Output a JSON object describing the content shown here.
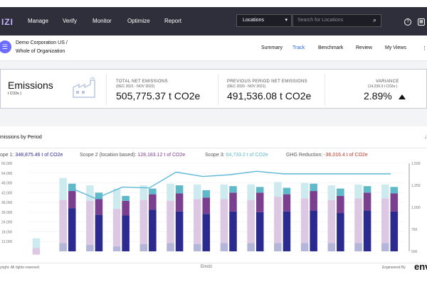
{
  "app": {
    "logo": "IZI"
  },
  "nav": {
    "items": [
      "Manage",
      "Verify",
      "Monitor",
      "Optimize",
      "Report"
    ]
  },
  "location_select": {
    "value": "Locations",
    "chevron": "▾"
  },
  "search": {
    "placeholder": "Search for Locations",
    "icon": "search-icon"
  },
  "top_icons": [
    "help-icon",
    "apps-icon"
  ],
  "breadcrumb": {
    "org": "Demo Corporation US",
    "separator": "/",
    "scope": "Whole of Organization"
  },
  "tabs": {
    "items": [
      "Summary",
      "Track",
      "Benchmark",
      "Review",
      "My Views"
    ],
    "active": "Track"
  },
  "stats": {
    "title": "Emissions",
    "unit": "t CO2e )",
    "total": {
      "label": "TOTAL NET EMISSIONS",
      "period": "(DEC 2021 - NOV 2022)",
      "value": "505,775.37 t CO2e"
    },
    "previous": {
      "label": "PREVIOUS PERIOD NET EMISSIONS",
      "period": "(DEC 2020 - NOV 2021)",
      "value": "491,536.08 t CO2e"
    },
    "variance": {
      "label": "VARIANCE",
      "period": "(14,239.3 t CO2e )",
      "value": "2.89%"
    }
  },
  "chart": {
    "title": "missions by Period",
    "legend": [
      {
        "label": "ope 1:",
        "value": "348,875.46 t of CO2e",
        "color": "#2b2a8f"
      },
      {
        "label": "Scope 2 (location based):",
        "value": "128,183.12 t of CO2e",
        "color": "#7b3f8f"
      },
      {
        "label": "Scope 3:",
        "value": "64,733.2 t of CO2e",
        "color": "#5fb9c8"
      },
      {
        "label": "GHG Reduction:",
        "value": "-36,016.4 t of CO2e",
        "color": "#c0392b"
      }
    ],
    "footer_left": "yright. All rights reserved.",
    "footer_mid": "Envizi",
    "footer_right": "Engineered By",
    "footer_logo": "env"
  },
  "chart_data": {
    "type": "bar",
    "y_ticks": [
      "12,000",
      "18,000",
      "24,000",
      "30,000",
      "36,000",
      "42,000",
      "48,000",
      "54,000",
      "60,000"
    ],
    "y2_ticks": [
      "500",
      "750",
      "1,000",
      "1,250",
      "1,500"
    ],
    "ylim": [
      6000,
      60000
    ],
    "y2lim": [
      500,
      1500
    ],
    "series": [
      {
        "values": [
          0,
          32500,
          28500,
          28000,
          31500,
          30500,
          29000,
          30500,
          30000,
          30500,
          31000,
          29500,
          31000,
          30500
        ]
      },
      {
        "values": [
          0,
          10500,
          9500,
          9000,
          9500,
          11000,
          10000,
          11500,
          12000,
          10500,
          12000,
          10500,
          11000,
          11000
        ]
      },
      {
        "values": [
          0,
          4500,
          4000,
          3000,
          3500,
          5000,
          4500,
          4000,
          3500,
          4000,
          4500,
          4500,
          4000,
          4000
        ]
      },
      {
        "values": [
          14000,
          51000,
          46500,
          44500,
          46500,
          47500,
          47000,
          47000,
          47000,
          48500,
          48000,
          46500,
          47000,
          47000
        ]
      },
      {
        "values": [
          8000,
          37500,
          37000,
          32000,
          37500,
          37000,
          38000,
          38000,
          37500,
          39500,
          38500,
          37500,
          38500,
          38500
        ]
      },
      {
        "values": [
          4000,
          11000,
          10000,
          9000,
          10500,
          11000,
          10500,
          11000,
          11000,
          11000,
          11000,
          11000,
          11000,
          11000
        ]
      }
    ],
    "line": {
      "values": [
        null,
        1230,
        1100,
        1230,
        1220,
        1400,
        1350,
        1370,
        1410,
        1380,
        1380,
        1380,
        1380,
        1380
      ]
    }
  }
}
